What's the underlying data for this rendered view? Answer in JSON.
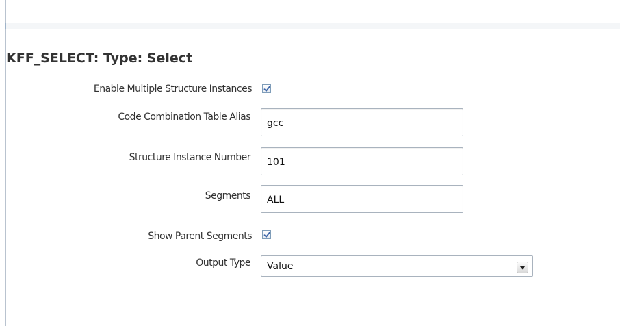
{
  "section": {
    "title": "KFF_SELECT: Type: Select"
  },
  "fields": {
    "enable_multiple_structure_instances": {
      "label": "Enable Multiple Structure Instances",
      "checked": true
    },
    "code_combination_table_alias": {
      "label": "Code Combination Table Alias",
      "value": "gcc"
    },
    "structure_instance_number": {
      "label": "Structure Instance Number",
      "value": "101"
    },
    "segments": {
      "label": "Segments",
      "value": "ALL"
    },
    "show_parent_segments": {
      "label": "Show Parent Segments",
      "checked": true
    },
    "output_type": {
      "label": "Output Type",
      "value": "Value"
    }
  },
  "colors": {
    "checkmark": "#3b64a8",
    "border": "#a9b3be"
  },
  "icons": {
    "checkbox_mark": "checkmark-icon",
    "dropdown": "chevron-down-icon"
  }
}
